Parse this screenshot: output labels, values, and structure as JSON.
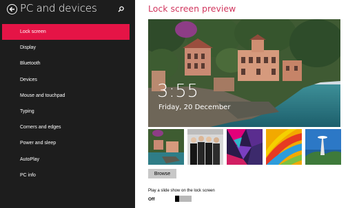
{
  "sidebar": {
    "title": "PC and devices",
    "items": [
      {
        "label": "Lock screen",
        "active": true
      },
      {
        "label": "Display"
      },
      {
        "label": "Bluetooth"
      },
      {
        "label": "Devices"
      },
      {
        "label": "Mouse and touchpad"
      },
      {
        "label": "Typing"
      },
      {
        "label": "Corners and edges"
      },
      {
        "label": "Power and sleep"
      },
      {
        "label": "AutoPlay"
      },
      {
        "label": "PC info"
      }
    ]
  },
  "main": {
    "title": "Lock screen preview",
    "preview": {
      "time": "3:55",
      "date": "Friday, 20 December"
    },
    "browse_label": "Browse",
    "slideshow": {
      "label": "Play a slide show on the lock screen",
      "state": "Off"
    }
  },
  "colors": {
    "accent": "#e51446",
    "heading": "#d1365e",
    "sidebar_bg": "#1d1d1d"
  }
}
